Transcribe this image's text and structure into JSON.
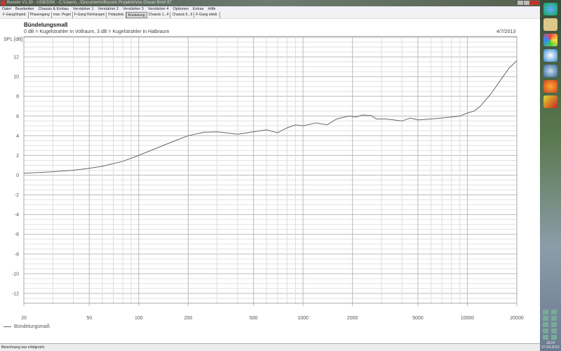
{
  "window": {
    "title": "Boxsim V1.30 - USB/DSK - C:\\Users\\...\\Documents\\Boxsim Projekte\\Vox Ozean Brett 87"
  },
  "menu": [
    "Datei",
    "Bearbeiten",
    "Chassis & Einbau",
    "Verstärker 1",
    "Verstärker 2",
    "Verstärker 3",
    "Verstärker 4",
    "Optionen",
    "Extras",
    "Hilfe"
  ],
  "tabs": [
    "F-Gang/Imped.",
    "Phasengang",
    "max. Pegel",
    "F-Gang Richtungen",
    "Polarplots",
    "Bündelung",
    "Chassis 1...4",
    "Chassis 5...6",
    "F-Gang elektr."
  ],
  "active_tab": 5,
  "plot": {
    "title": "Bündelungsmaß",
    "subtitle": "0 dB = Kugelstrahler in Vollraum, 3 dB = Kugelstrahler in Halbraum",
    "date": "4/7/2013"
  },
  "status": "Berechnung war erfolgreich.",
  "taskbar": {
    "time": "18:24",
    "date": "07.04.2013"
  },
  "chart_data": {
    "type": "line",
    "title": "Bündelungsmaß",
    "xlabel": "",
    "ylabel": "SPL [dB]",
    "xscale": "log",
    "xlim": [
      20,
      20000
    ],
    "ylim": [
      -13,
      14
    ],
    "xticks": [
      20,
      50,
      100,
      200,
      500,
      1000,
      2000,
      5000,
      10000,
      20000
    ],
    "yticks": [
      12,
      10,
      8,
      6,
      4,
      2,
      0,
      -2,
      -4,
      -6,
      -8,
      -10,
      -12
    ],
    "grid": true,
    "legend": "bottom-left",
    "series": [
      {
        "name": "Bündelungsmaß",
        "color": "#666666",
        "x": [
          20,
          30,
          40,
          50,
          60,
          80,
          100,
          150,
          200,
          250,
          300,
          400,
          500,
          600,
          700,
          800,
          900,
          1000,
          1200,
          1400,
          1600,
          1900,
          2100,
          2300,
          2600,
          2800,
          3200,
          4000,
          4500,
          5000,
          6000,
          7000,
          8000,
          9000,
          10000,
          11000,
          12000,
          14000,
          16000,
          18000,
          20000
        ],
        "y": [
          0.2,
          0.35,
          0.5,
          0.7,
          0.9,
          1.4,
          2.0,
          3.2,
          4.0,
          4.35,
          4.4,
          4.15,
          4.4,
          4.6,
          4.3,
          4.8,
          5.1,
          5.0,
          5.3,
          5.1,
          5.7,
          6.0,
          5.9,
          6.1,
          6.05,
          5.7,
          5.7,
          5.5,
          5.8,
          5.6,
          5.7,
          5.8,
          5.9,
          6.0,
          6.3,
          6.5,
          7.0,
          8.3,
          9.7,
          10.9,
          11.6
        ]
      }
    ]
  }
}
